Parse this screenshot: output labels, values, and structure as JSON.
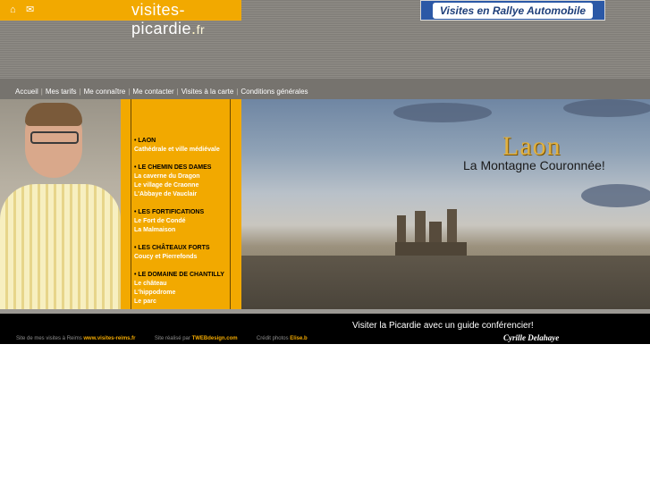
{
  "header": {
    "logo_text": "visites-picardie",
    "logo_dot": ".",
    "logo_tld": "fr",
    "home_icon": "home-icon",
    "mail_icon": "mail-icon",
    "banner_label": "Visites en Rallye Automobile"
  },
  "nav": {
    "items": [
      "Accueil",
      "Mes tarifs",
      "Me connaître",
      "Me contacter",
      "Visites à la carte",
      "Conditions générales"
    ],
    "separator": "|"
  },
  "menu": {
    "sections": [
      {
        "title": "• LAON",
        "links": [
          "Cathédrale et ville médiévale"
        ]
      },
      {
        "title": "• LE CHEMIN DES DAMES",
        "links": [
          "La caverne du Dragon",
          "Le village de Craonne",
          "L'Abbaye de Vauclair"
        ]
      },
      {
        "title": "• LES FORTIFICATIONS",
        "links": [
          "Le Fort de Condé",
          "La Malmaison"
        ]
      },
      {
        "title": "• LES CHÂTEAUX FORTS",
        "links": [
          "Coucy et Pierrefonds"
        ]
      },
      {
        "title": "• LE DOMAINE DE CHANTILLY",
        "links": [
          "Le château",
          "L'hippodrome",
          "Le parc"
        ]
      }
    ]
  },
  "hero": {
    "title": "Laon",
    "subtitle": "La Montagne Couronnée!"
  },
  "footer": {
    "text1": "Site de mes visites à Reims",
    "link1": "www.visites-reims.fr",
    "text2": "Site réalisé par",
    "link2": "TWEBdesign.com",
    "text3": "Crédit photos",
    "link3": "Elise.b",
    "tagline": "Visiter la Picardie avec un guide conférencier!",
    "signature": "Cyrille Delahaye"
  },
  "colors": {
    "accent_orange": "#f2a900",
    "header_grey": "#8f8c86",
    "footer_black": "#000000"
  }
}
